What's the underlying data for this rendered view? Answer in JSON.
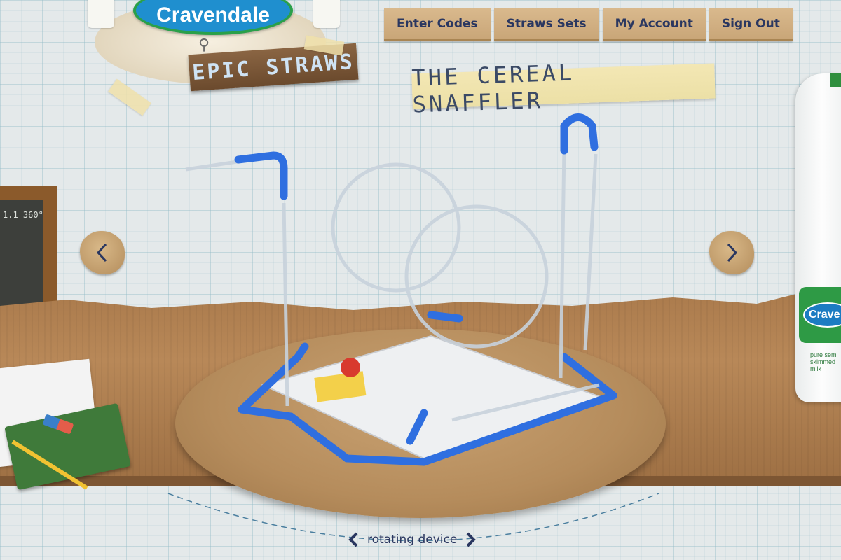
{
  "logo": {
    "brand": "Cravendale",
    "subtitle": "EPIC STRAWS"
  },
  "nav": {
    "items": [
      {
        "label": "Enter Codes"
      },
      {
        "label": "Straws Sets"
      },
      {
        "label": "My Account"
      },
      {
        "label": "Sign Out"
      }
    ]
  },
  "product": {
    "title": "THE CEREAL SNAFFLER"
  },
  "blackboard": {
    "text": "1.1 360°"
  },
  "milk": {
    "brand": "Crave",
    "description": "pure semi skimmed milk"
  },
  "controls": {
    "prev_icon": "chevron-left-icon",
    "next_icon": "chevron-right-icon",
    "rotate_label": "rotating device"
  },
  "colors": {
    "nav_text": "#2a3760",
    "straw_blue": "#2f6fe0",
    "brand_blue": "#1f8fcf",
    "brand_green": "#2aa04a"
  }
}
